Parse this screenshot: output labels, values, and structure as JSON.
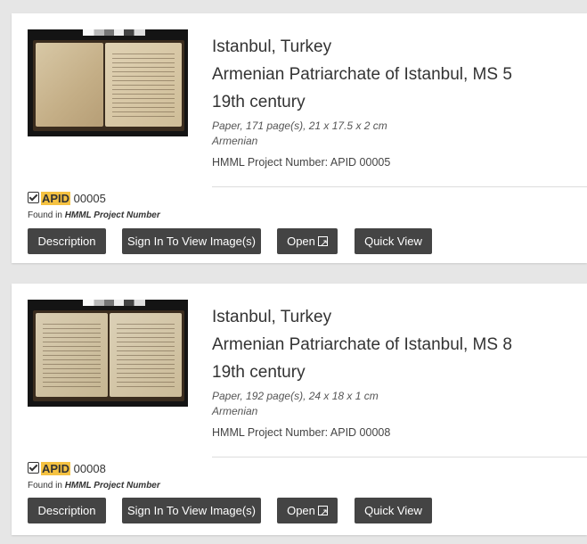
{
  "results": [
    {
      "location": "Istanbul, Turkey",
      "repository": "Armenian Patriarchate of Istanbul, MS 5",
      "century": "19th century",
      "physical": "Paper, 171 page(s), 21 x 17.5 x 2 cm",
      "language": "Armenian",
      "project_number": "HMML Project Number: APID 00005",
      "match_highlight": "APID",
      "match_rest": " 00005",
      "found_prefix": "Found in ",
      "found_field": "HMML Project Number",
      "buttons": {
        "description": "Description",
        "sign_in": "Sign In To View Image(s)",
        "open": "Open",
        "quick_view": "Quick View"
      }
    },
    {
      "location": "Istanbul, Turkey",
      "repository": "Armenian Patriarchate of Istanbul, MS 8",
      "century": "19th century",
      "physical": "Paper, 192 page(s), 24 x 18 x 1 cm",
      "language": "Armenian",
      "project_number": "HMML Project Number: APID 00008",
      "match_highlight": "APID",
      "match_rest": " 00008",
      "found_prefix": "Found in ",
      "found_field": "HMML Project Number",
      "buttons": {
        "description": "Description",
        "sign_in": "Sign In To View Image(s)",
        "open": "Open",
        "quick_view": "Quick View"
      }
    }
  ],
  "colors": {
    "highlight": "#f5c242",
    "button_bg": "#444444",
    "page_bg": "#e6e6e6"
  },
  "icons": {
    "match": "checkbox-checked-icon",
    "open": "external-link-icon"
  }
}
